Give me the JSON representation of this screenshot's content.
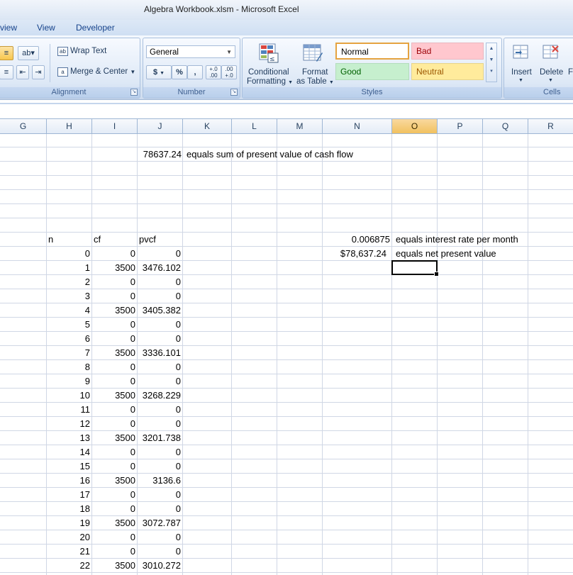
{
  "window": {
    "title": "Algebra Workbook.xlsm - Microsoft Excel"
  },
  "tabs": [
    "view",
    "View",
    "Developer"
  ],
  "ribbon": {
    "alignment": {
      "wrap_text": "Wrap Text",
      "merge_center": "Merge & Center",
      "label": "Alignment"
    },
    "number": {
      "format": "General",
      "currency": "$",
      "percent": "%",
      "comma": ",",
      "inc_decimal": "+.0 .00",
      "dec_decimal": ".00 +.0",
      "label": "Number"
    },
    "styles": {
      "conditional": "Conditional",
      "conditional2": "Formatting",
      "format_as": "Format",
      "format_as2": "as Table",
      "normal": "Normal",
      "bad": "Bad",
      "good": "Good",
      "neutral": "Neutral",
      "label": "Styles",
      "colors": {
        "normal_border": "#e5a340",
        "bad_bg": "#ffc7ce",
        "bad_fg": "#9c0006",
        "good_bg": "#c6efce",
        "good_fg": "#006100",
        "neutral_bg": "#ffeb9c",
        "neutral_fg": "#9c5700"
      }
    },
    "cells": {
      "insert": "Insert",
      "delete": "Delete",
      "format_partial": "Fo",
      "label": "Cells"
    }
  },
  "columns": [
    "G",
    "H",
    "I",
    "J",
    "K",
    "L",
    "M",
    "N",
    "O",
    "P",
    "Q",
    "R"
  ],
  "active_column": "O",
  "sheet": {
    "sum_value": "78637.24",
    "sum_label": "equals sum of present value of cash flow",
    "headers": {
      "n": "n",
      "cf": "cf",
      "pvcf": "pvcf"
    },
    "rate_value": "0.006875",
    "rate_label": "equals interest rate per month",
    "npv_value": "$78,637.24",
    "npv_label": "equals net present value",
    "rows": [
      {
        "n": "0",
        "cf": "0",
        "pvcf": "0"
      },
      {
        "n": "1",
        "cf": "3500",
        "pvcf": "3476.102"
      },
      {
        "n": "2",
        "cf": "0",
        "pvcf": "0"
      },
      {
        "n": "3",
        "cf": "0",
        "pvcf": "0"
      },
      {
        "n": "4",
        "cf": "3500",
        "pvcf": "3405.382"
      },
      {
        "n": "5",
        "cf": "0",
        "pvcf": "0"
      },
      {
        "n": "6",
        "cf": "0",
        "pvcf": "0"
      },
      {
        "n": "7",
        "cf": "3500",
        "pvcf": "3336.101"
      },
      {
        "n": "8",
        "cf": "0",
        "pvcf": "0"
      },
      {
        "n": "9",
        "cf": "0",
        "pvcf": "0"
      },
      {
        "n": "10",
        "cf": "3500",
        "pvcf": "3268.229"
      },
      {
        "n": "11",
        "cf": "0",
        "pvcf": "0"
      },
      {
        "n": "12",
        "cf": "0",
        "pvcf": "0"
      },
      {
        "n": "13",
        "cf": "3500",
        "pvcf": "3201.738"
      },
      {
        "n": "14",
        "cf": "0",
        "pvcf": "0"
      },
      {
        "n": "15",
        "cf": "0",
        "pvcf": "0"
      },
      {
        "n": "16",
        "cf": "3500",
        "pvcf": "3136.6"
      },
      {
        "n": "17",
        "cf": "0",
        "pvcf": "0"
      },
      {
        "n": "18",
        "cf": "0",
        "pvcf": "0"
      },
      {
        "n": "19",
        "cf": "3500",
        "pvcf": "3072.787"
      },
      {
        "n": "20",
        "cf": "0",
        "pvcf": "0"
      },
      {
        "n": "21",
        "cf": "0",
        "pvcf": "0"
      },
      {
        "n": "22",
        "cf": "3500",
        "pvcf": "3010.272"
      }
    ]
  }
}
